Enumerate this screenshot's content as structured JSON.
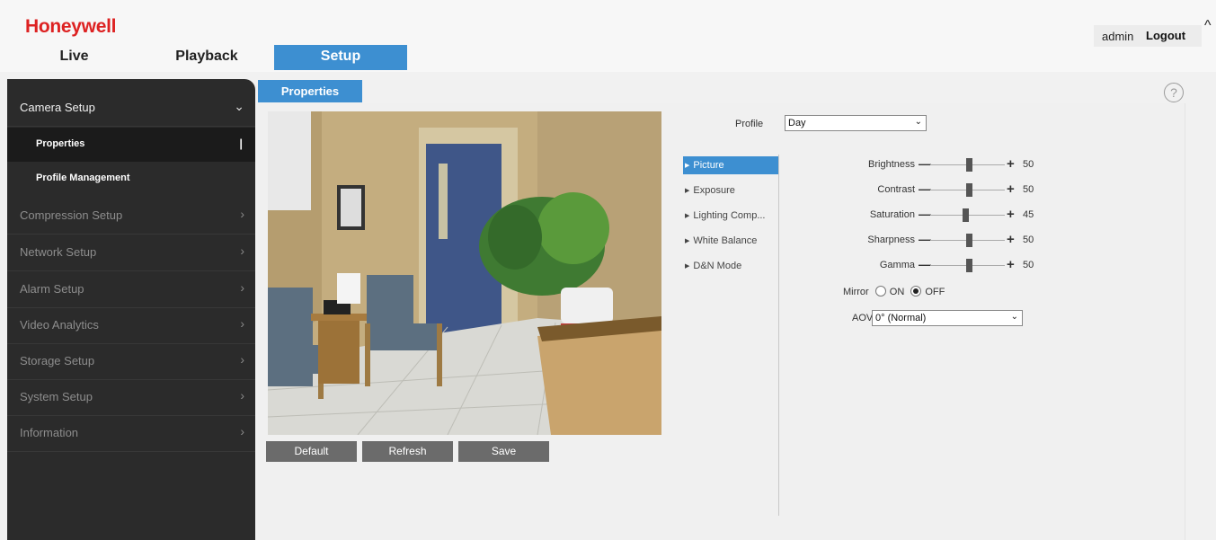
{
  "header": {
    "logo_text": "Honeywell",
    "user": "admin",
    "logout_label": "Logout",
    "nav_tabs": [
      {
        "label": "Live",
        "active": false
      },
      {
        "label": "Playback",
        "active": false
      },
      {
        "label": "Setup",
        "active": true
      }
    ]
  },
  "sidebar": {
    "items": [
      {
        "label": "Camera Setup",
        "expanded": true
      },
      {
        "label": "Compression Setup"
      },
      {
        "label": "Network Setup"
      },
      {
        "label": "Alarm Setup"
      },
      {
        "label": "Video Analytics"
      },
      {
        "label": "Storage Setup"
      },
      {
        "label": "System Setup"
      },
      {
        "label": "Information"
      }
    ],
    "subitems": [
      {
        "label": "Properties",
        "active": true
      },
      {
        "label": "Profile Management"
      }
    ]
  },
  "content": {
    "tab_label": "Properties",
    "buttons": {
      "default": "Default",
      "refresh": "Refresh",
      "save": "Save"
    },
    "profile": {
      "label": "Profile",
      "value": "Day"
    },
    "categories": [
      "Picture",
      "Exposure",
      "Lighting Comp...",
      "White Balance",
      "D&N Mode"
    ],
    "sliders": [
      {
        "label": "Brightness",
        "value": 50
      },
      {
        "label": "Contrast",
        "value": 50
      },
      {
        "label": "Saturation",
        "value": 45
      },
      {
        "label": "Sharpness",
        "value": 50
      },
      {
        "label": "Gamma",
        "value": 50
      }
    ],
    "mirror": {
      "label": "Mirror",
      "on_label": "ON",
      "off_label": "OFF",
      "value": "OFF"
    },
    "aov": {
      "label": "AOV",
      "value": "0° (Normal)"
    }
  },
  "colors": {
    "accent": "#3d8fd1",
    "brand": "#d22222",
    "sidebar_bg": "#2b2b2b",
    "button_bg": "#6b6b6b"
  },
  "icons": {
    "help": "help-icon",
    "expand": "chevron-down-icon",
    "collapsed": "chevron-right-icon",
    "logout_caret": "caret-up-icon"
  }
}
